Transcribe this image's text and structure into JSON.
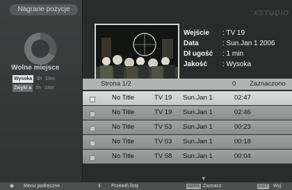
{
  "left_panel": {
    "title": "Nagrane pozycje",
    "free_space_label": "Wolne miejsce",
    "quality_rows": [
      {
        "name": "Wysoka",
        "hours": "3h",
        "minutes": "19m"
      },
      {
        "name": "Zwyki a",
        "hours": "5h",
        "minutes": "24m"
      }
    ]
  },
  "right_panel": {
    "logo": "XSTUDIO",
    "info": [
      {
        "key": "Wejście",
        "value": ": TV 19"
      },
      {
        "key": "Data",
        "value": ": Sun.Jan 1 2006"
      },
      {
        "key": "Dł ugość",
        "value": ": 1 min"
      },
      {
        "key": "Jakość",
        "value": ": Wysoka"
      }
    ],
    "list_header": {
      "page": "Strona   1/2",
      "count": "0",
      "selected_label": "Zaznaczono"
    },
    "rows": [
      {
        "title": "No Title",
        "channel": "TV 19",
        "date": "Sun.Jan 1",
        "time": "02:47"
      },
      {
        "title": "No Title",
        "channel": "TV 19",
        "date": "Sun.Jan 1",
        "time": "02:46"
      },
      {
        "title": "No Title",
        "channel": "TV 53",
        "date": "Sun.Jan 1",
        "time": "00:23"
      },
      {
        "title": "No Title",
        "channel": "TV 53",
        "date": "Sun.Jan 1",
        "time": "00:18"
      },
      {
        "title": "No Title",
        "channel": "TV 58",
        "date": "Sun.Jan 1",
        "time": "00:04"
      }
    ]
  },
  "bottom_bar": {
    "menu_label": "Menu podręczne",
    "scroll_label": "Przewiń listę",
    "mark_key": "MARK",
    "mark_label": "Zaznacz",
    "exit_key": "EXIT",
    "exit_label": "Wyj"
  }
}
